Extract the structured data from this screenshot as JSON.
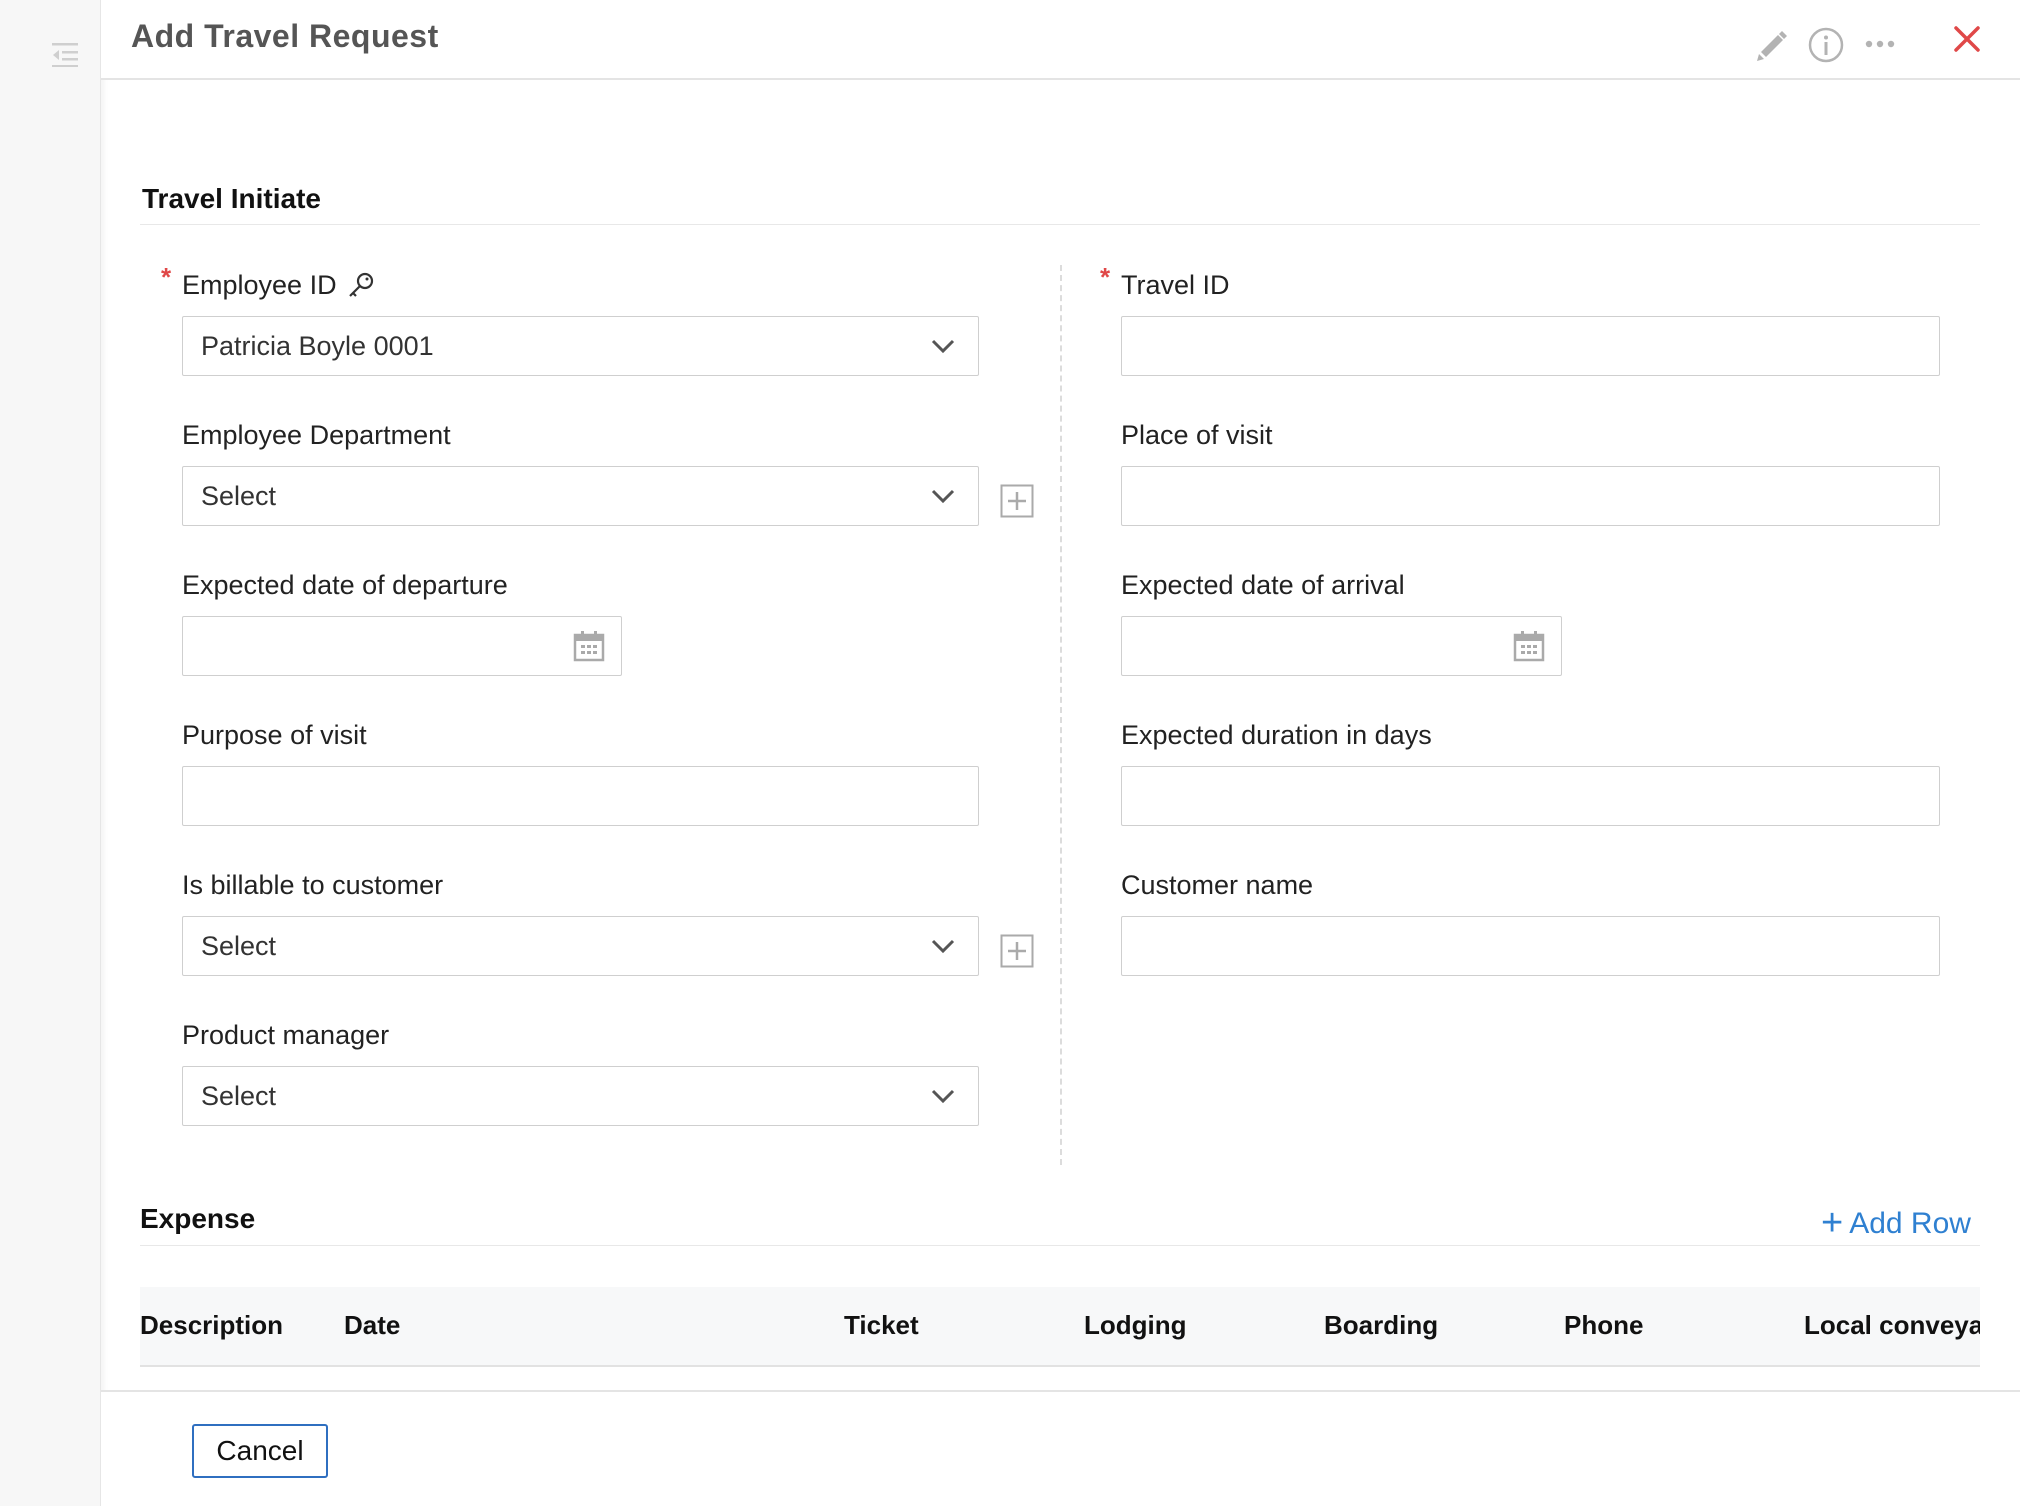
{
  "dialog": {
    "title": "Add Travel Request"
  },
  "sections": {
    "travel_initiate": "Travel Initiate",
    "expense": "Expense"
  },
  "left_fields": {
    "employee_id": {
      "label": "Employee ID",
      "value": "Patricia Boyle 0001",
      "required": true
    },
    "employee_department": {
      "label": "Employee Department",
      "value": "Select"
    },
    "departure_date": {
      "label": "Expected date of departure",
      "value": ""
    },
    "purpose": {
      "label": "Purpose of visit",
      "value": ""
    },
    "billable": {
      "label": "Is billable to customer",
      "value": "Select"
    },
    "product_manager": {
      "label": "Product manager",
      "value": "Select"
    }
  },
  "right_fields": {
    "travel_id": {
      "label": "Travel ID",
      "value": "",
      "required": true
    },
    "place_of_visit": {
      "label": "Place of visit",
      "value": ""
    },
    "arrival_date": {
      "label": "Expected date of arrival",
      "value": ""
    },
    "duration_days": {
      "label": "Expected duration in days",
      "value": ""
    },
    "customer_name": {
      "label": "Customer name",
      "value": ""
    }
  },
  "required_marker": "*",
  "expense": {
    "add_row_label": "Add Row",
    "add_row_icon": "+",
    "columns": [
      "Description",
      "Date",
      "Ticket",
      "Lodging",
      "Boarding",
      "Phone",
      "Local conveya"
    ]
  },
  "footer": {
    "cancel_label": "Cancel"
  },
  "colors": {
    "accent": "#2f80d1",
    "required": "#e04848",
    "close": "#e04848"
  },
  "icons": [
    "sidebar-toggle-icon",
    "edit-icon",
    "info-icon",
    "more-icon",
    "close-icon",
    "key-icon",
    "chevron-down-icon",
    "calendar-icon",
    "add-option-icon",
    "plus-icon"
  ]
}
